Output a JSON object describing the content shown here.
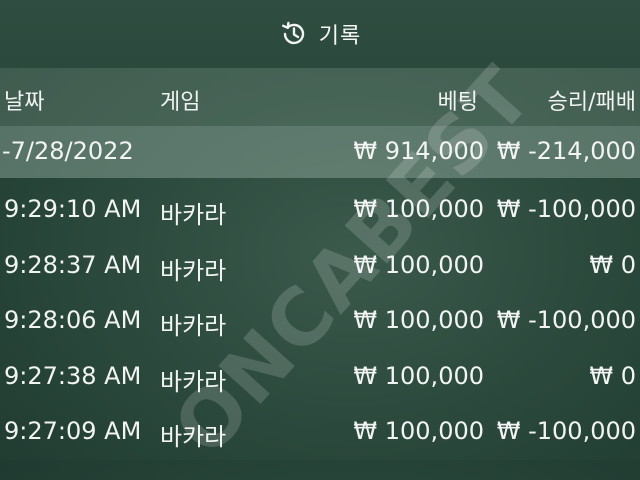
{
  "header": {
    "title": "기록"
  },
  "columns": {
    "date": "날짜",
    "game": "게임",
    "bet": "베팅",
    "win_loss": "승리/패배"
  },
  "summary": {
    "date": "-7/28/2022",
    "bet": "₩ 914,000",
    "win_loss": "₩ -214,000"
  },
  "rows": [
    {
      "time": "9:29:10 AM",
      "game": "바카라",
      "bet": "₩ 100,000",
      "win_loss": "₩ -100,000"
    },
    {
      "time": "9:28:37 AM",
      "game": "바카라",
      "bet": "₩ 100,000",
      "win_loss": "₩ 0"
    },
    {
      "time": "9:28:06 AM",
      "game": "바카라",
      "bet": "₩ 100,000",
      "win_loss": "₩ -100,000"
    },
    {
      "time": "9:27:38 AM",
      "game": "바카라",
      "bet": "₩ 100,000",
      "win_loss": "₩ 0"
    },
    {
      "time": "9:27:09 AM",
      "game": "바카라",
      "bet": "₩ 100,000",
      "win_loss": "₩ -100,000"
    }
  ],
  "watermark": {
    "text": "ONCABEST"
  },
  "icons": {
    "title_icon": "history-icon"
  },
  "colors": {
    "background": "#2c4a3d",
    "header_band": "#5f7c70",
    "summary_band": "#7f9a8f",
    "text": "#f2f4f3"
  }
}
